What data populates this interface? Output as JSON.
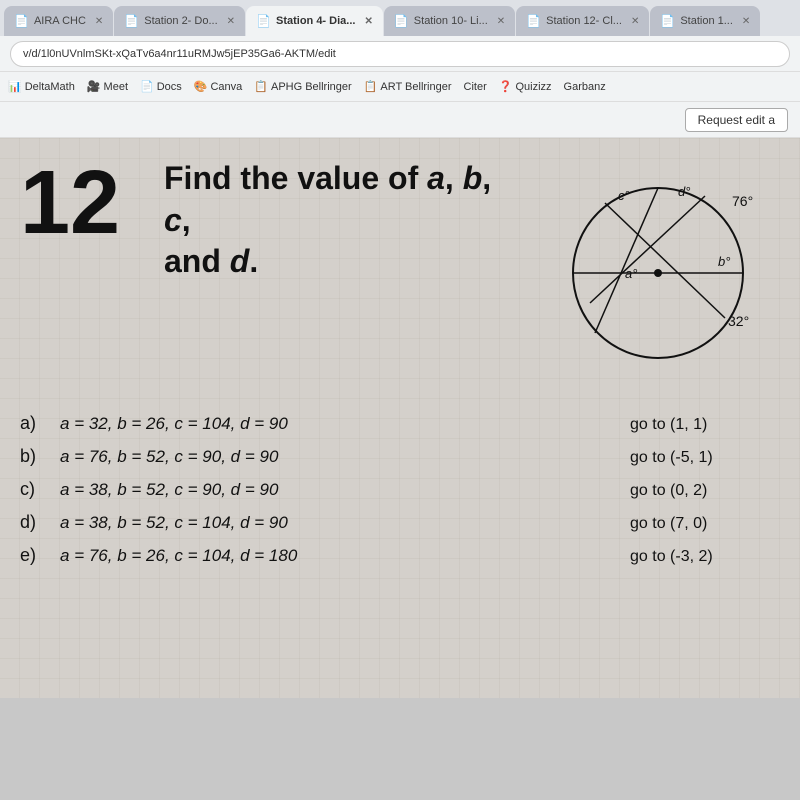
{
  "tabs": [
    {
      "label": "AIRA CHC",
      "active": false,
      "icon": "📄"
    },
    {
      "label": "Station 2- Do...",
      "active": false,
      "icon": "📄"
    },
    {
      "label": "Station 4- Dia...",
      "active": true,
      "icon": "📄"
    },
    {
      "label": "Station 10- Li...",
      "active": false,
      "icon": "📄"
    },
    {
      "label": "Station 12- Cl...",
      "active": false,
      "icon": "📄"
    },
    {
      "label": "Station 1...",
      "active": false,
      "icon": "📄"
    }
  ],
  "address": "v/d/1l0nUVnlmSKt-xQaTv6a4nr11uRMJw5jEP35Ga6-AKTM/edit",
  "bookmarks": [
    "DeltaMath",
    "Meet",
    "Docs",
    "Canva",
    "APHG Bellringer",
    "ART Bellringer",
    "Citer",
    "Quizizz",
    "Garbanz"
  ],
  "request_edit_label": "Request edit a",
  "question_number": "12",
  "question_text": "Find the value of a, b, c,\nand d.",
  "circle_labels": {
    "c": "c°",
    "d": "d°",
    "outer_angle": "76°",
    "b": "b°",
    "a": "a°",
    "bottom_angle": "32°"
  },
  "answers": [
    {
      "letter": "a)",
      "equation": "a = 32,  b = 26,  c = 104,  d = 90",
      "goto": "go to (1, 1)"
    },
    {
      "letter": "b)",
      "equation": "a = 76,  b = 52,  c = 90,  d = 90",
      "goto": "go to (-5, 1)"
    },
    {
      "letter": "c)",
      "equation": "a = 38,  b = 52,  c = 90,  d = 90",
      "goto": "go to (0, 2)"
    },
    {
      "letter": "d)",
      "equation": "a = 38,  b = 52,  c = 104,  d = 90",
      "goto": "go to (7, 0)"
    },
    {
      "letter": "e)",
      "equation": "a = 76,  b = 26,  c = 104,  d = 180",
      "goto": "go to (-3, 2)"
    }
  ]
}
